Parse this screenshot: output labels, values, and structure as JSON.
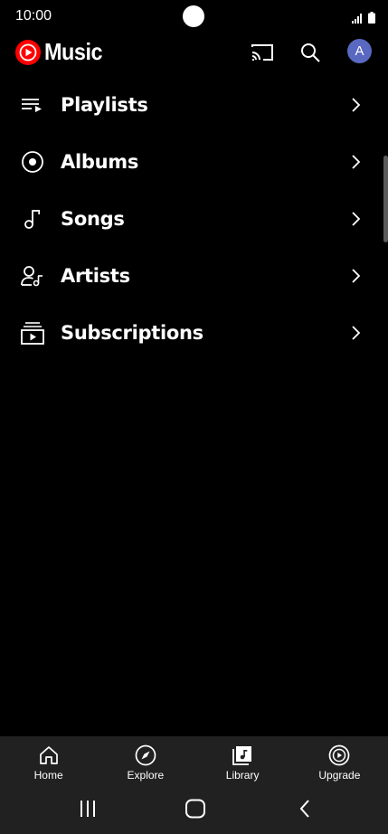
{
  "status_bar": {
    "time": "10:00"
  },
  "header": {
    "app_name": "Music",
    "avatar_letter": "A",
    "icons": [
      "cast-icon",
      "search-icon",
      "avatar"
    ]
  },
  "menu": {
    "items": [
      {
        "label": "Playlists",
        "icon": "playlist-icon"
      },
      {
        "label": "Albums",
        "icon": "album-icon"
      },
      {
        "label": "Songs",
        "icon": "song-note-icon"
      },
      {
        "label": "Artists",
        "icon": "artist-icon"
      },
      {
        "label": "Subscriptions",
        "icon": "subscriptions-icon"
      }
    ]
  },
  "bottom_nav": {
    "items": [
      {
        "label": "Home",
        "icon": "home-icon"
      },
      {
        "label": "Explore",
        "icon": "compass-icon"
      },
      {
        "label": "Library",
        "icon": "library-icon"
      },
      {
        "label": "Upgrade",
        "icon": "upgrade-icon"
      }
    ]
  },
  "colors": {
    "background": "#000000",
    "brand_red": "#ff0000",
    "nav_background": "#212121",
    "avatar": "#5968c0"
  }
}
